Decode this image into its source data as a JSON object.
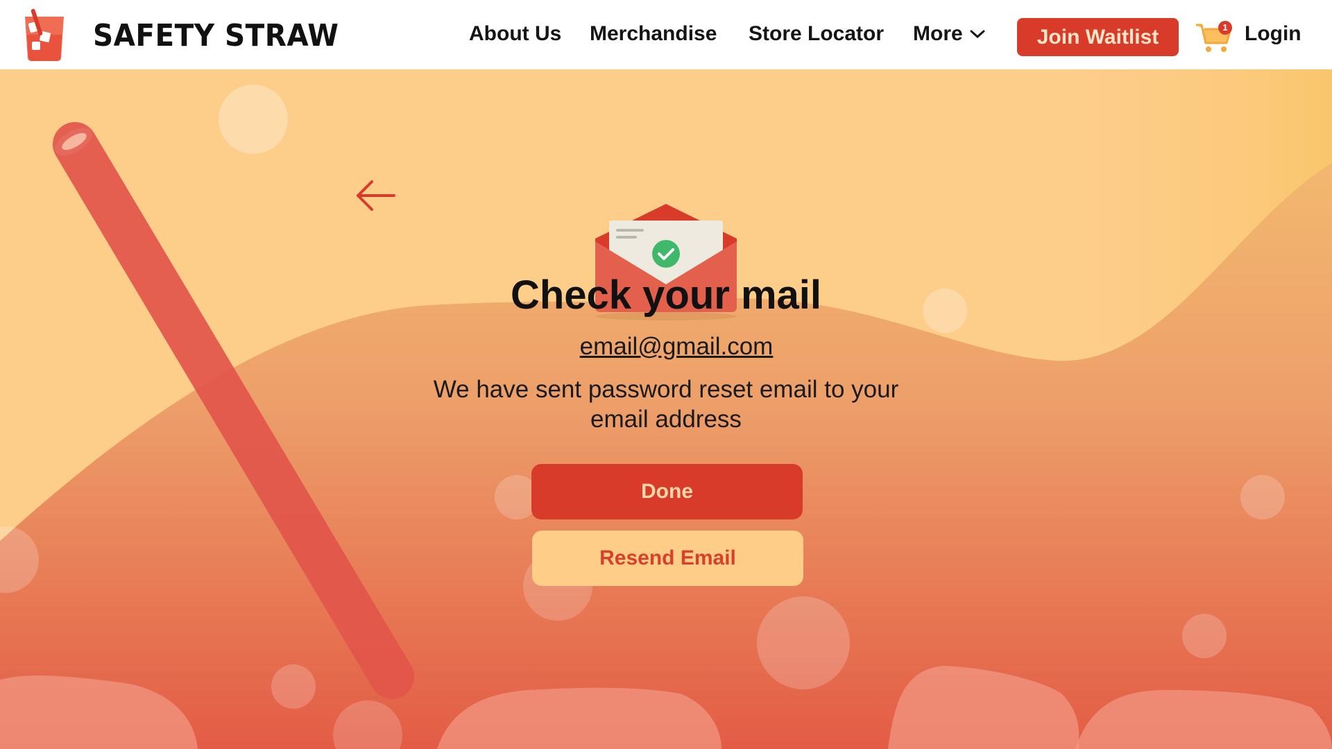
{
  "header": {
    "brand": "SAFETY STRAW",
    "nav": {
      "about": "About Us",
      "merch": "Merchandise",
      "store": "Store Locator",
      "more": "More"
    },
    "join_label": "Join Waitlist",
    "cart_count": "1",
    "login_label": "Login"
  },
  "main": {
    "title": "Check your mail",
    "email": "email@gmail.com",
    "message": "We have sent password reset email to your email address",
    "done_label": "Done",
    "resend_label": "Resend Email"
  },
  "icons": {
    "logo": "glass-straw-logo-icon",
    "more": "chevron-down-icon",
    "cart": "shopping-cart-icon",
    "back": "arrow-left-icon",
    "envelope": "open-envelope-check-icon"
  },
  "colors": {
    "accent": "#d93b2b",
    "accent_text": "#ffd6a8",
    "cream": "#fecd87",
    "background_top": "#fdcd8a",
    "background_bottom": "#e4614a"
  }
}
